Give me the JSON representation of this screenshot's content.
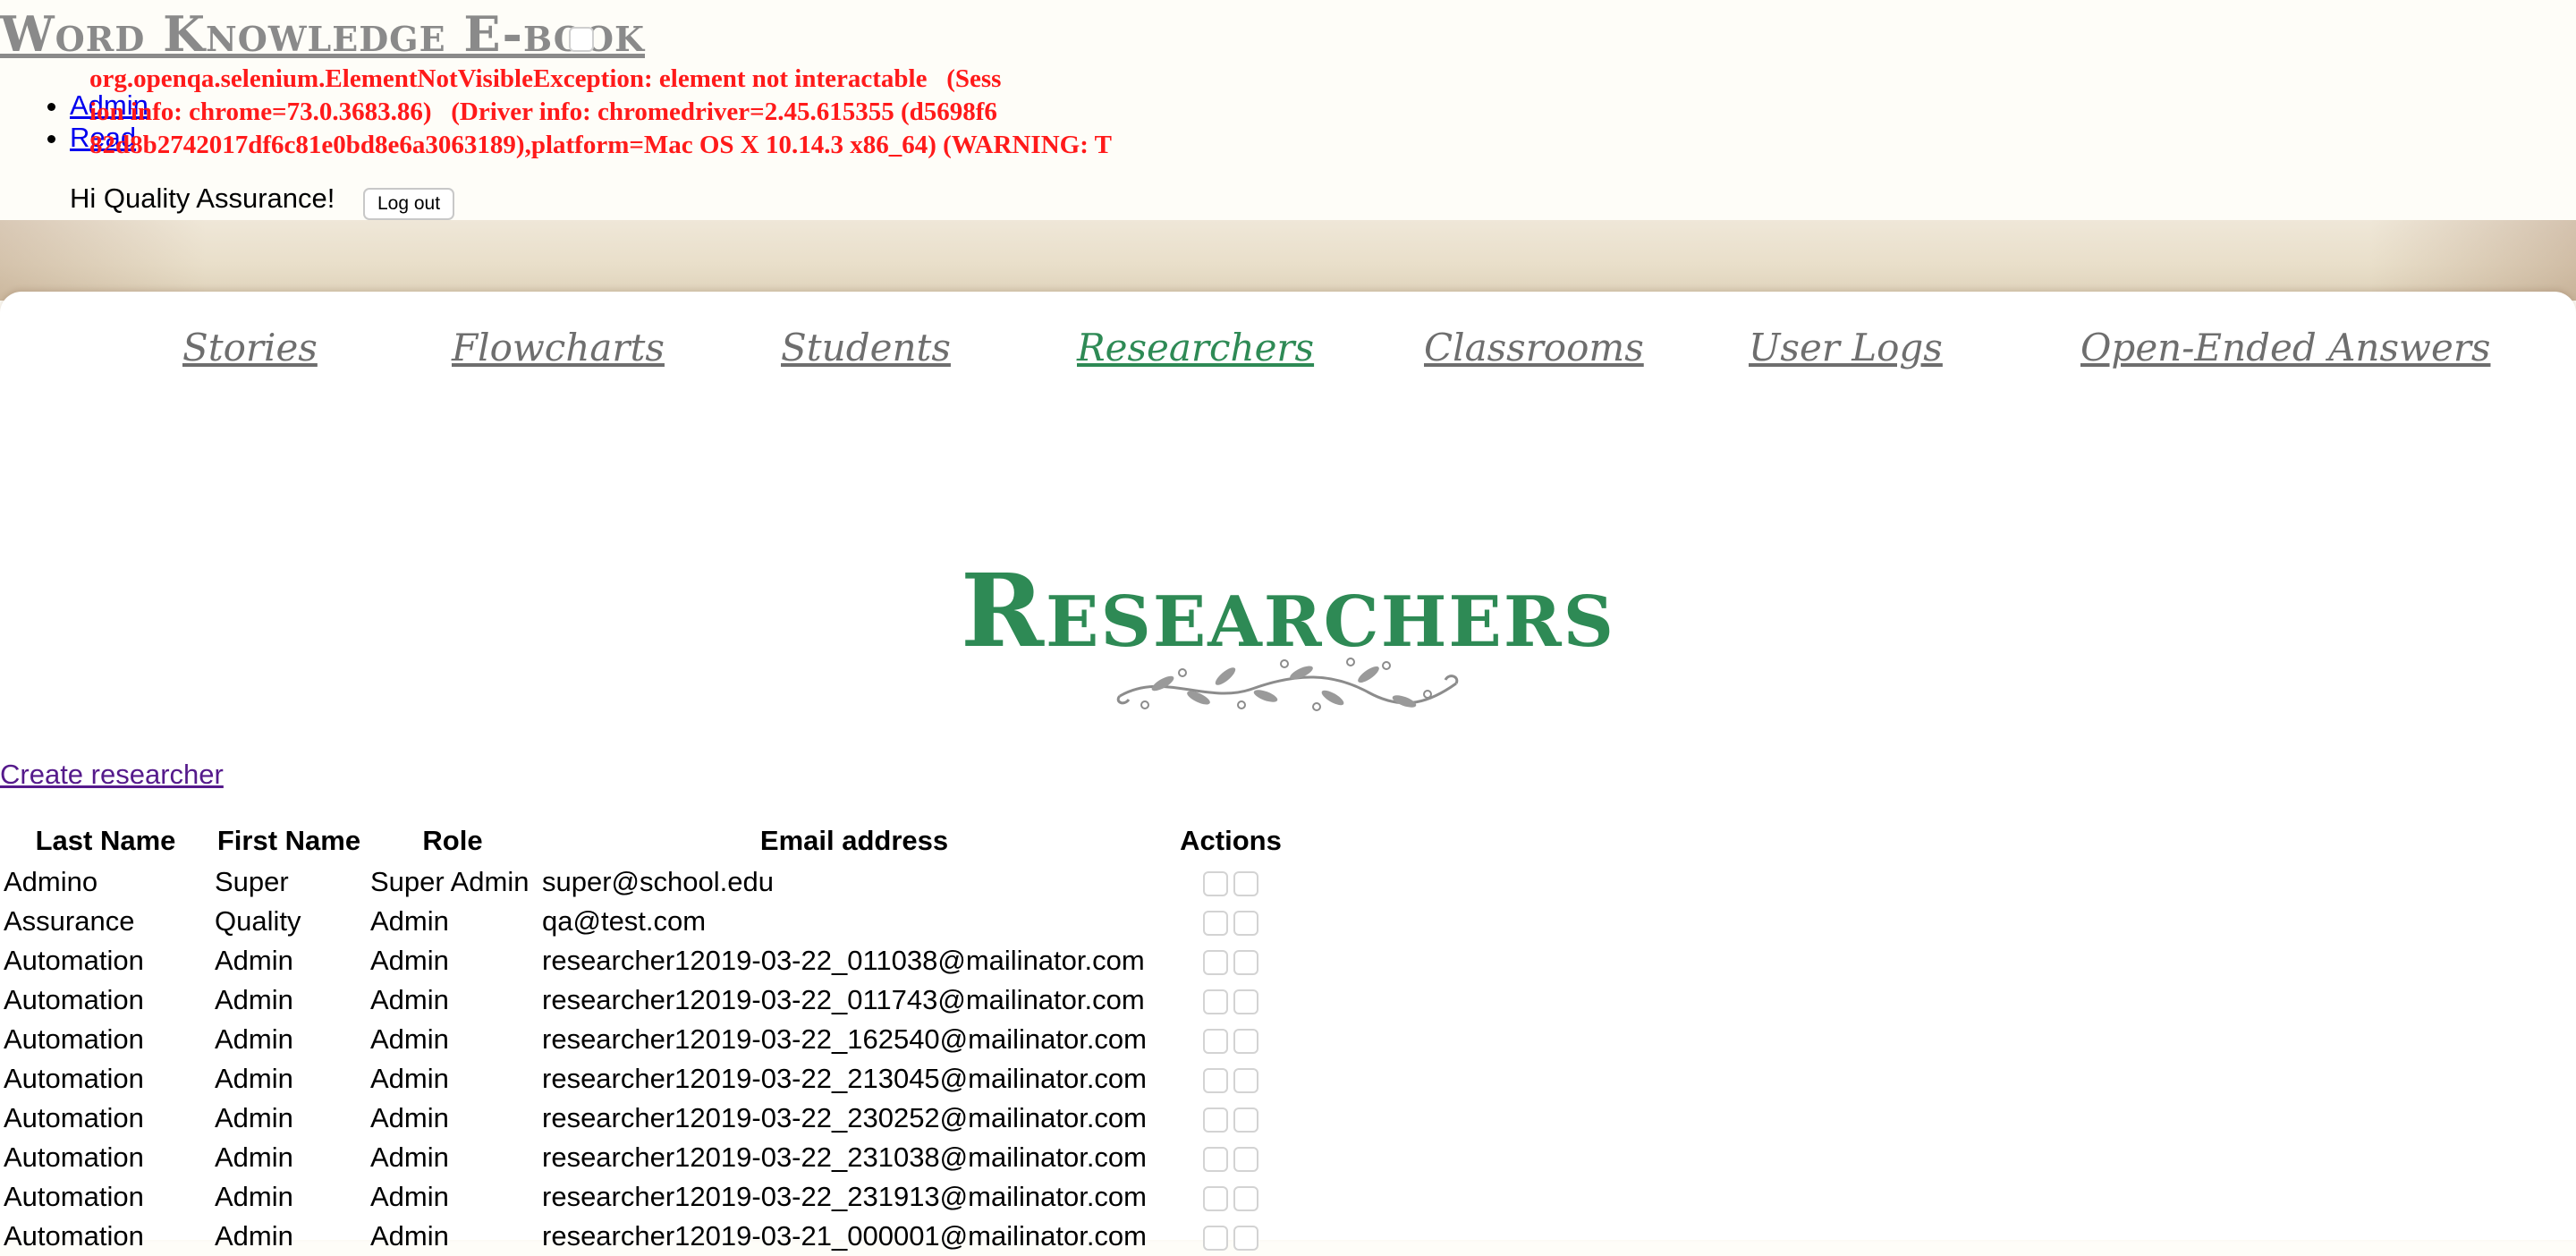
{
  "site": {
    "title": "Word Knowledge E-book"
  },
  "top_nav": {
    "items": [
      {
        "label": "Admin"
      },
      {
        "label": "Read"
      }
    ]
  },
  "error": {
    "line1": "org.openqa.selenium.ElementNotVisibleException: element not interactable   (Sess",
    "line2": "ion info: chrome=73.0.3683.86)   (Driver info: chromedriver=2.45.615355 (d5698f6",
    "line3": "82d8b2742017df6c81e0bd8e6a3063189),platform=Mac OS X 10.14.3 x86_64) (WARNING: T"
  },
  "user": {
    "greeting": "Hi Quality Assurance!",
    "logout_label": "Log out"
  },
  "main_nav": {
    "items": [
      {
        "label": "Stories"
      },
      {
        "label": "Flowcharts"
      },
      {
        "label": "Students"
      },
      {
        "label": "Researchers",
        "active": true
      },
      {
        "label": "Classrooms"
      },
      {
        "label": "User Logs"
      },
      {
        "label": "Open-Ended Answers"
      }
    ]
  },
  "colors": {
    "accent_green": "#2e8a55",
    "nav_gray": "#6e6e6e",
    "error_red": "#ff1a1a"
  },
  "page": {
    "heading": "Researchers",
    "create_link": "Create researcher"
  },
  "table": {
    "headers": [
      "Last Name",
      "First Name",
      "Role",
      "Email address",
      "Actions"
    ],
    "rows": [
      [
        "Admino",
        "Super",
        "Super Admin",
        "super@school.edu"
      ],
      [
        "Assurance",
        "Quality",
        "Admin",
        "qa@test.com"
      ],
      [
        "Automation",
        "Admin",
        "Admin",
        "researcher12019-03-22_011038@mailinator.com"
      ],
      [
        "Automation",
        "Admin",
        "Admin",
        "researcher12019-03-22_011743@mailinator.com"
      ],
      [
        "Automation",
        "Admin",
        "Admin",
        "researcher12019-03-22_162540@mailinator.com"
      ],
      [
        "Automation",
        "Admin",
        "Admin",
        "researcher12019-03-22_213045@mailinator.com"
      ],
      [
        "Automation",
        "Admin",
        "Admin",
        "researcher12019-03-22_230252@mailinator.com"
      ],
      [
        "Automation",
        "Admin",
        "Admin",
        "researcher12019-03-22_231038@mailinator.com"
      ],
      [
        "Automation",
        "Admin",
        "Admin",
        "researcher12019-03-22_231913@mailinator.com"
      ],
      [
        "Automation",
        "Admin",
        "Admin",
        "researcher12019-03-21_000001@mailinator.com"
      ]
    ]
  }
}
